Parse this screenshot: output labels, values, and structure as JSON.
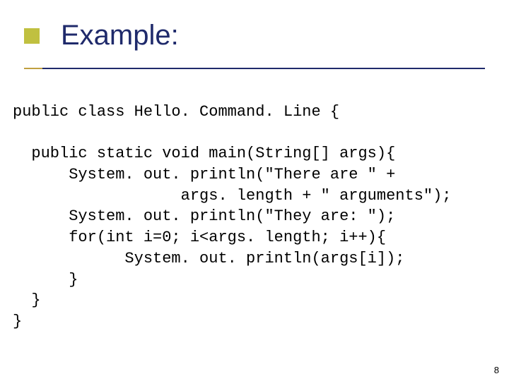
{
  "title": "Example:",
  "code": {
    "l1": "public class Hello. Command. Line {",
    "l2": "",
    "l3": "  public static void main(String[] args){",
    "l4": "      System. out. println(\"There are \" +",
    "l5": "                  args. length + \" arguments\");",
    "l6": "      System. out. println(\"They are: \");",
    "l7": "      for(int i=0; i<args. length; i++){",
    "l8": "            System. out. println(args[i]);",
    "l9": "      }",
    "l10": "  }",
    "l11": "}"
  },
  "pageNumber": "8"
}
